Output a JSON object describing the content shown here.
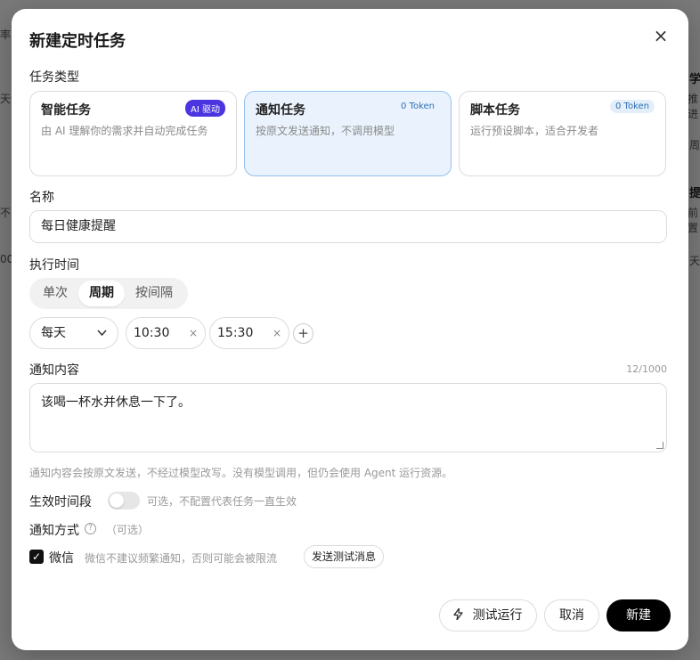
{
  "background": {
    "fragments": [
      "率",
      "学",
      "推进",
      "天气",
      "周",
      "提",
      "前置",
      "不同",
      "00",
      "天"
    ]
  },
  "dialog": {
    "title": "新建定时任务",
    "close_icon": "close-icon"
  },
  "task_type": {
    "label": "任务类型",
    "cards": [
      {
        "title": "智能任务",
        "badge": "AI 驱动",
        "desc": "由 AI 理解你的需求并自动完成任务",
        "selected": false
      },
      {
        "title": "通知任务",
        "badge": "0 Token",
        "desc": "按原文发送通知，不调用模型",
        "selected": true
      },
      {
        "title": "脚本任务",
        "badge": "0 Token",
        "desc": "运行预设脚本，适合开发者",
        "selected": false
      }
    ]
  },
  "name": {
    "label": "名称",
    "value": "每日健康提醒"
  },
  "schedule": {
    "label": "执行时间",
    "modes": [
      "单次",
      "周期",
      "按间隔"
    ],
    "selected_mode": "周期",
    "frequency": "每天",
    "times": [
      "10:30",
      "15:30"
    ],
    "remove_icon": "×",
    "add_icon": "+"
  },
  "content": {
    "label": "通知内容",
    "count": "12/1000",
    "value": "该喝一杯水并休息一下了。",
    "hint": "通知内容会按原文发送，不经过模型改写。没有模型调用，但仍会使用 Agent 运行资源。"
  },
  "active_period": {
    "label": "生效时间段",
    "enabled": false,
    "hint": "可选，不配置代表任务一直生效"
  },
  "notify": {
    "label": "通知方式",
    "help_icon": "?",
    "optional": "（可选）",
    "channel_label": "微信",
    "channel_checked": true,
    "channel_hint": "微信不建议频繁通知，否则可能会被限流",
    "send_test": "发送测试消息"
  },
  "footer": {
    "test_run": "测试运行",
    "cancel": "取消",
    "create": "新建"
  },
  "colors": {
    "selected_card_bg": "#eaf3fd",
    "selected_card_border": "#93c2ee",
    "ai_badge": "#4b35e0",
    "primary": "#000000"
  }
}
